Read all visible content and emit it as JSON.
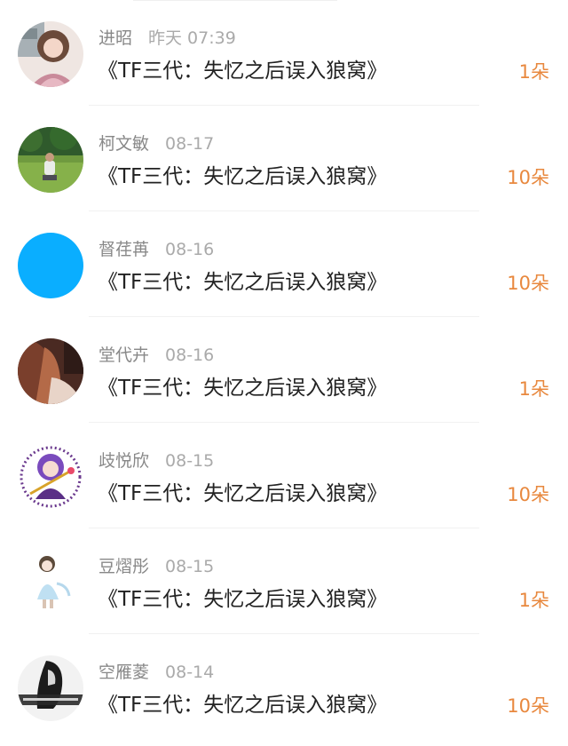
{
  "colors": {
    "gift_orange": "#e8883e",
    "name_gray": "#888888",
    "time_gray": "#aaaaaa",
    "title_dark": "#222222",
    "avatar_blue": "#0aaeff"
  },
  "records": [
    {
      "name": "进昭",
      "time": "昨天 07:39",
      "title": "《TF三代：失忆之后误入狼窝》",
      "gift": "1朵",
      "avatar": "girl-photo"
    },
    {
      "name": "柯文敏",
      "time": "08-17",
      "title": "《TF三代：失忆之后误入狼窝》",
      "gift": "10朵",
      "avatar": "park-photo"
    },
    {
      "name": "督荏苒",
      "time": "08-16",
      "title": "《TF三代：失忆之后误入狼窝》",
      "gift": "10朵",
      "avatar": "blue-circle"
    },
    {
      "name": "堂代卉",
      "time": "08-16",
      "title": "《TF三代：失忆之后误入狼窝》",
      "gift": "1朵",
      "avatar": "longhair-photo"
    },
    {
      "name": "歧悦欣",
      "time": "08-15",
      "title": "《TF三代：失忆之后误入狼窝》",
      "gift": "10朵",
      "avatar": "anime-girl"
    },
    {
      "name": "豆熠彤",
      "time": "08-15",
      "title": "《TF三代：失忆之后误入狼窝》",
      "gift": "1朵",
      "avatar": "child-drawing"
    },
    {
      "name": "空雁菱",
      "time": "08-14",
      "title": "《TF三代：失忆之后误入狼窝》",
      "gift": "10朵",
      "avatar": "bw-portrait"
    }
  ]
}
